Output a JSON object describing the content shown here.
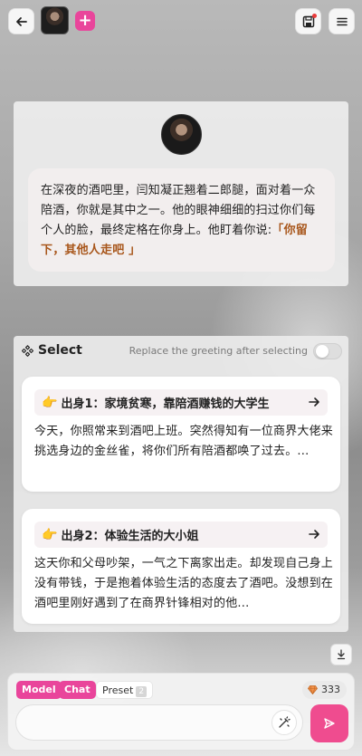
{
  "header": {
    "back_icon": "arrow-left-icon",
    "plus_label": "+",
    "save_icon": "floppy-disk-icon",
    "menu_icon": "hamburger-menu-icon",
    "accent": "#e9459b"
  },
  "greeting": {
    "text": "在深夜的酒吧里，闫知凝正翘着二郎腿，面对着一众陪酒，你就是其中之一。他的眼神细细的扫过你们每个人的脸，最终定格在你身上。他盯着你说:",
    "quote": "「你留下，其他人走吧 」",
    "quote_color": "#a8561b"
  },
  "select": {
    "title": "Select",
    "hint": "Replace the greeting after selecting",
    "toggle_on": false,
    "options": [
      {
        "emoji": "👉",
        "title": "出身1：家境贫寒，靠陪酒赚钱的大学生",
        "desc": "今天，你照常来到酒吧上班。突然得知有一位商界大佬来挑选身边的金丝雀，将你们所有陪酒都唤了过去。..."
      },
      {
        "emoji": "👉",
        "title": "出身2：体验生活的大小姐",
        "desc": "这天你和父母吵架，一气之下离家出走。却发现自己身上没有带钱，于是抱着体验生活的态度去了酒吧。没想到在酒吧里刚好遇到了在商界针锋相对的他..."
      }
    ]
  },
  "bottom": {
    "model_label": "Model",
    "chat_label": "Chat",
    "preset_label": "Preset",
    "preset_count": "2",
    "credits": "333",
    "input_value": "",
    "send_color": "#ef4c8f"
  }
}
